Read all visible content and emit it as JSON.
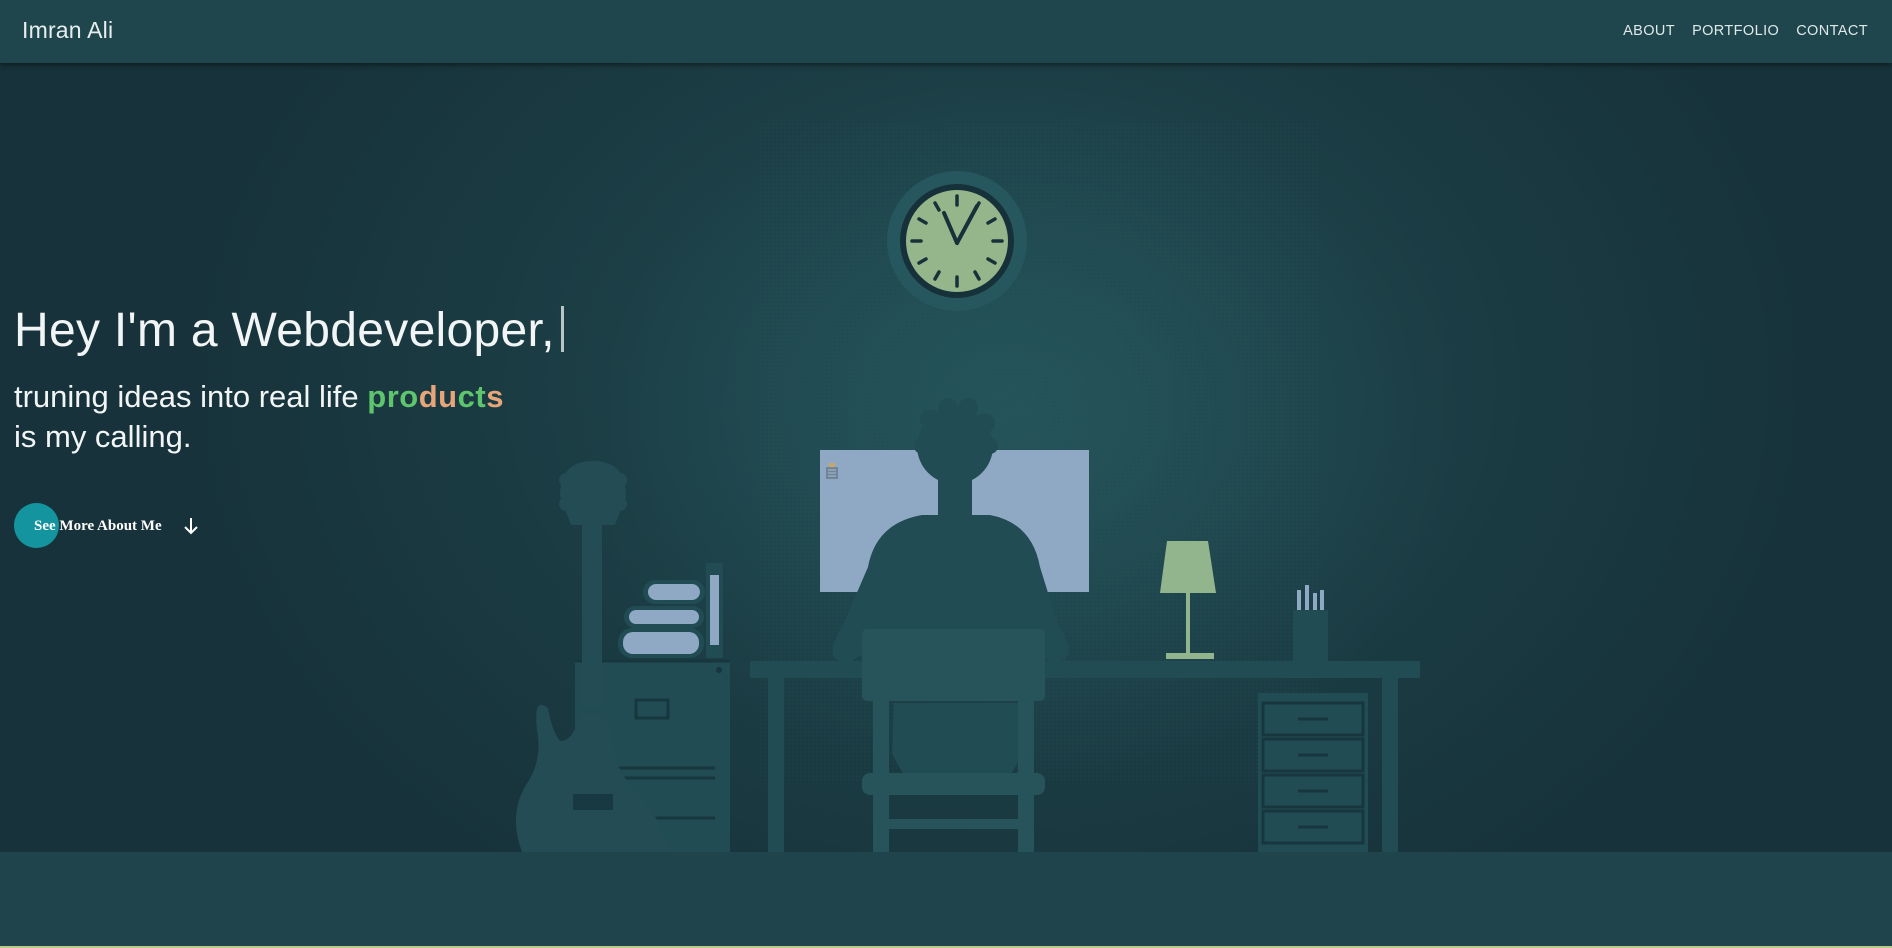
{
  "brand": {
    "name": "Imran Ali"
  },
  "nav": {
    "items": [
      {
        "label": "ABOUT"
      },
      {
        "label": "PORTFOLIO"
      },
      {
        "label": "CONTACT"
      }
    ]
  },
  "hero": {
    "headline": "Hey I'm a Webdeveloper,",
    "subline_part1": "truning ideas into real life",
    "highlight_letters": [
      {
        "ch": "p",
        "color": "#5fc46e"
      },
      {
        "ch": "r",
        "color": "#5fc46e"
      },
      {
        "ch": "o",
        "color": "#5fc46e"
      },
      {
        "ch": "d",
        "color": "#e8a57a"
      },
      {
        "ch": "u",
        "color": "#e8a57a"
      },
      {
        "ch": "c",
        "color": "#5fc46e"
      },
      {
        "ch": "t",
        "color": "#5fc46e"
      },
      {
        "ch": "s",
        "color": "#e8a57a"
      }
    ],
    "subline_part2": "is my calling.",
    "cta_label": "See More About Me"
  },
  "icons": {
    "cta_arrow": "arrow-down-icon"
  },
  "colors": {
    "topbar": "#1f464c",
    "hero_bg": "#1c3f46",
    "accent_teal": "#14949e",
    "highlight_green": "#5fc46e",
    "highlight_peach": "#e8a57a"
  }
}
